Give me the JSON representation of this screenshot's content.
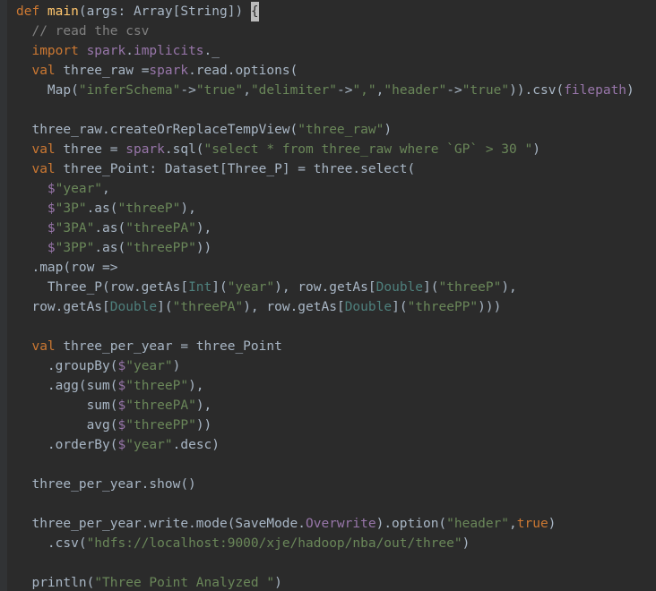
{
  "code": {
    "tokens": [
      [
        [
          "kw",
          "def "
        ],
        [
          "fn",
          "main"
        ],
        [
          "punc",
          "(args: Array[String]) "
        ],
        [
          "cursor",
          "{"
        ]
      ],
      [
        [
          "punc",
          "  "
        ],
        [
          "cmt",
          "// read the csv"
        ]
      ],
      [
        [
          "punc",
          "  "
        ],
        [
          "kw",
          "import "
        ],
        [
          "id2",
          "spark"
        ],
        [
          "punc",
          "."
        ],
        [
          "id2",
          "implicits"
        ],
        [
          "punc",
          "._"
        ]
      ],
      [
        [
          "punc",
          "  "
        ],
        [
          "kw",
          "val "
        ],
        [
          "punc",
          "three_raw ="
        ],
        [
          "id2",
          "spark"
        ],
        [
          "punc",
          ".read.options("
        ]
      ],
      [
        [
          "punc",
          "    Map("
        ],
        [
          "str",
          "\"inferSchema\""
        ],
        [
          "punc",
          "->"
        ],
        [
          "str",
          "\"true\""
        ],
        [
          "punc",
          ","
        ],
        [
          "str",
          "\"delimiter\""
        ],
        [
          "punc",
          "->"
        ],
        [
          "str",
          "\",\""
        ],
        [
          "punc",
          ","
        ],
        [
          "str",
          "\"header\""
        ],
        [
          "punc",
          "->"
        ],
        [
          "str",
          "\"true\""
        ],
        [
          "punc",
          ")).csv("
        ],
        [
          "id2",
          "filepath"
        ],
        [
          "punc",
          ")"
        ]
      ],
      [],
      [
        [
          "punc",
          "  three_raw.createOrReplaceTempView("
        ],
        [
          "str",
          "\"three_raw\""
        ],
        [
          "punc",
          ")"
        ]
      ],
      [
        [
          "punc",
          "  "
        ],
        [
          "kw",
          "val "
        ],
        [
          "punc",
          "three = "
        ],
        [
          "id2",
          "spark"
        ],
        [
          "punc",
          ".sql("
        ],
        [
          "str",
          "\"select * from three_raw where `GP` > 30 \""
        ],
        [
          "punc",
          ")"
        ]
      ],
      [
        [
          "punc",
          "  "
        ],
        [
          "kw",
          "val "
        ],
        [
          "punc",
          "three_Point: Dataset[Three_P] = three.select("
        ]
      ],
      [
        [
          "punc",
          "    "
        ],
        [
          "id2",
          "$"
        ],
        [
          "str",
          "\"year\""
        ],
        [
          "punc",
          ","
        ]
      ],
      [
        [
          "punc",
          "    "
        ],
        [
          "id2",
          "$"
        ],
        [
          "str",
          "\"3P\""
        ],
        [
          "punc",
          ".as("
        ],
        [
          "str",
          "\"threeP\""
        ],
        [
          "punc",
          "),"
        ]
      ],
      [
        [
          "punc",
          "    "
        ],
        [
          "id2",
          "$"
        ],
        [
          "str",
          "\"3PA\""
        ],
        [
          "punc",
          ".as("
        ],
        [
          "str",
          "\"threePA\""
        ],
        [
          "punc",
          "),"
        ]
      ],
      [
        [
          "punc",
          "    "
        ],
        [
          "id2",
          "$"
        ],
        [
          "str",
          "\"3PP\""
        ],
        [
          "punc",
          ".as("
        ],
        [
          "str",
          "\"threePP\""
        ],
        [
          "punc",
          "))"
        ]
      ],
      [
        [
          "punc",
          "  .map(row =>"
        ]
      ],
      [
        [
          "punc",
          "    Three_P(row.getAs["
        ],
        [
          "typ",
          "Int"
        ],
        [
          "punc",
          "]("
        ],
        [
          "str",
          "\"year\""
        ],
        [
          "punc",
          "), row.getAs["
        ],
        [
          "typ",
          "Double"
        ],
        [
          "punc",
          "]("
        ],
        [
          "str",
          "\"threeP\""
        ],
        [
          "punc",
          "),"
        ]
      ],
      [
        [
          "punc",
          "  row.getAs["
        ],
        [
          "typ",
          "Double"
        ],
        [
          "punc",
          "]("
        ],
        [
          "str",
          "\"threePA\""
        ],
        [
          "punc",
          "), row.getAs["
        ],
        [
          "typ",
          "Double"
        ],
        [
          "punc",
          "]("
        ],
        [
          "str",
          "\"threePP\""
        ],
        [
          "punc",
          ")))"
        ]
      ],
      [],
      [
        [
          "punc",
          "  "
        ],
        [
          "kw",
          "val "
        ],
        [
          "punc",
          "three_per_year = three_Point"
        ]
      ],
      [
        [
          "punc",
          "    .groupBy("
        ],
        [
          "id2",
          "$"
        ],
        [
          "str",
          "\"year\""
        ],
        [
          "punc",
          ")"
        ]
      ],
      [
        [
          "punc",
          "    .agg(sum("
        ],
        [
          "id2",
          "$"
        ],
        [
          "str",
          "\"threeP\""
        ],
        [
          "punc",
          "),"
        ]
      ],
      [
        [
          "punc",
          "         sum("
        ],
        [
          "id2",
          "$"
        ],
        [
          "str",
          "\"threePA\""
        ],
        [
          "punc",
          "),"
        ]
      ],
      [
        [
          "punc",
          "         avg("
        ],
        [
          "id2",
          "$"
        ],
        [
          "str",
          "\"threePP\""
        ],
        [
          "punc",
          "))"
        ]
      ],
      [
        [
          "punc",
          "    .orderBy("
        ],
        [
          "id2",
          "$"
        ],
        [
          "str",
          "\"year\""
        ],
        [
          "punc",
          ".desc)"
        ]
      ],
      [],
      [
        [
          "punc",
          "  three_per_year.show()"
        ]
      ],
      [],
      [
        [
          "punc",
          "  three_per_year.write.mode(SaveMode."
        ],
        [
          "id2",
          "Overwrite"
        ],
        [
          "punc",
          ").option("
        ],
        [
          "str",
          "\"header\""
        ],
        [
          "punc",
          ","
        ],
        [
          "kw",
          "true"
        ],
        [
          "punc",
          ")"
        ]
      ],
      [
        [
          "punc",
          "    .csv("
        ],
        [
          "str",
          "\"hdfs://localhost:9000/xje/hadoop/nba/out/three\""
        ],
        [
          "punc",
          ")"
        ]
      ],
      [],
      [
        [
          "punc",
          "  println("
        ],
        [
          "str",
          "\"Three Point Analyzed \""
        ],
        [
          "punc",
          ")"
        ]
      ]
    ]
  }
}
